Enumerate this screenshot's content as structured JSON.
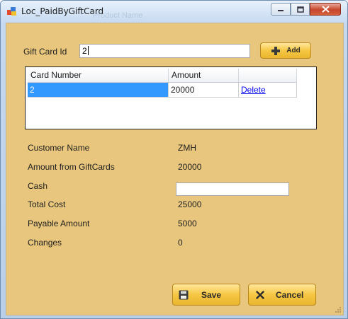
{
  "window": {
    "title": "Loc_PaidByGiftCard",
    "ghost_title": "Product Name"
  },
  "gift_card": {
    "label": "Gift Card Id",
    "value": "2",
    "add_button": "Add"
  },
  "grid": {
    "columns": [
      "Card Number",
      "Amount",
      ""
    ],
    "rows": [
      {
        "card_number": "2",
        "amount": "20000",
        "action": "Delete"
      }
    ]
  },
  "summary": {
    "customer_name_label": "Customer Name",
    "customer_name_value": "ZMH",
    "amount_from_giftcards_label": "Amount from GiftCards",
    "amount_from_giftcards_value": "20000",
    "cash_label": "Cash",
    "cash_value": "",
    "total_cost_label": "Total Cost",
    "total_cost_value": "25000",
    "payable_amount_label": "Payable Amount",
    "payable_amount_value": "5000",
    "changes_label": "Changes",
    "changes_value": "0"
  },
  "buttons": {
    "save": "Save",
    "cancel": "Cancel"
  },
  "colors": {
    "form_background": "#e8c67d",
    "button_gold": "#f6c744",
    "selection_blue": "#3399ff"
  }
}
